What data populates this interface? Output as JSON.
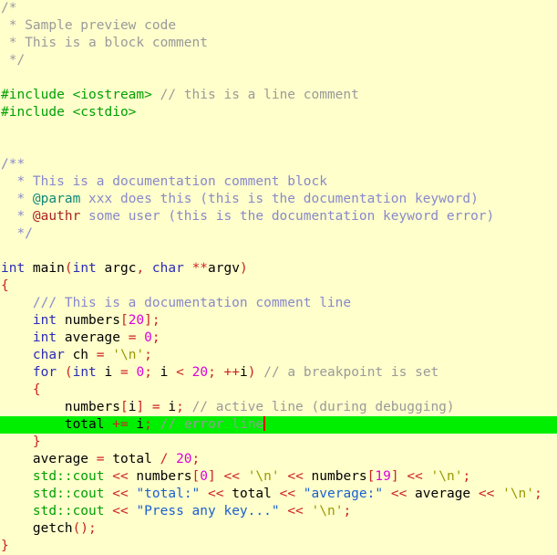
{
  "editor": {
    "language": "C++",
    "background_color": "#ffffcc",
    "highlight_line_color": "#00ee00",
    "caret_color": "#dd0000",
    "colors": {
      "plain": "#000000",
      "keyword": "#2b2bb7",
      "preprocessor": "#00a000",
      "comment": "#9a9a9a",
      "documentation": "#8888cc",
      "documentation_keyword": "#118877",
      "documentation_keyword_error": "#aa2222",
      "number": "#dd00dd",
      "string": "#1a5fd0",
      "character": "#999900",
      "operator": "#cc2222"
    }
  },
  "lines": [
    {
      "id": 1,
      "tokens": [
        {
          "t": "/*",
          "c": "comment"
        }
      ]
    },
    {
      "id": 2,
      "tokens": [
        {
          "t": " * Sample preview code",
          "c": "comment"
        }
      ]
    },
    {
      "id": 3,
      "tokens": [
        {
          "t": " * This is a block comment",
          "c": "comment"
        }
      ]
    },
    {
      "id": 4,
      "tokens": [
        {
          "t": " */",
          "c": "comment"
        }
      ]
    },
    {
      "id": 5,
      "tokens": [
        {
          "t": "",
          "c": "plain"
        }
      ]
    },
    {
      "id": 6,
      "tokens": [
        {
          "t": "#include",
          "c": "preproc"
        },
        {
          "t": " ",
          "c": "plain"
        },
        {
          "t": "<iostream>",
          "c": "preproc"
        },
        {
          "t": " ",
          "c": "plain"
        },
        {
          "t": "// this is a line comment",
          "c": "comment"
        }
      ]
    },
    {
      "id": 7,
      "tokens": [
        {
          "t": "#include",
          "c": "preproc"
        },
        {
          "t": " ",
          "c": "plain"
        },
        {
          "t": "<cstdio>",
          "c": "preproc"
        }
      ]
    },
    {
      "id": 8,
      "tokens": [
        {
          "t": "",
          "c": "plain"
        }
      ]
    },
    {
      "id": 9,
      "tokens": [
        {
          "t": "",
          "c": "plain"
        }
      ]
    },
    {
      "id": 10,
      "tokens": [
        {
          "t": "/**",
          "c": "doc"
        }
      ]
    },
    {
      "id": 11,
      "tokens": [
        {
          "t": "  * This is a documentation comment block",
          "c": "doc"
        }
      ]
    },
    {
      "id": 12,
      "tokens": [
        {
          "t": "  * ",
          "c": "doc"
        },
        {
          "t": "@param",
          "c": "docword"
        },
        {
          "t": " xxx does this (this is the documentation keyword)",
          "c": "doc"
        }
      ]
    },
    {
      "id": 13,
      "tokens": [
        {
          "t": "  * ",
          "c": "doc"
        },
        {
          "t": "@authr",
          "c": "docerr"
        },
        {
          "t": " some user (this is the documentation keyword error)",
          "c": "doc"
        }
      ]
    },
    {
      "id": 14,
      "tokens": [
        {
          "t": "  */",
          "c": "doc"
        }
      ]
    },
    {
      "id": 15,
      "tokens": [
        {
          "t": "",
          "c": "plain"
        }
      ]
    },
    {
      "id": 16,
      "tokens": [
        {
          "t": "int",
          "c": "keyword"
        },
        {
          "t": " main",
          "c": "plain"
        },
        {
          "t": "(",
          "c": "punct"
        },
        {
          "t": "int",
          "c": "keyword"
        },
        {
          "t": " argc",
          "c": "plain"
        },
        {
          "t": ",",
          "c": "punct"
        },
        {
          "t": " ",
          "c": "plain"
        },
        {
          "t": "char",
          "c": "keyword"
        },
        {
          "t": " ",
          "c": "plain"
        },
        {
          "t": "**",
          "c": "punct"
        },
        {
          "t": "argv",
          "c": "plain"
        },
        {
          "t": ")",
          "c": "punct"
        }
      ]
    },
    {
      "id": 17,
      "tokens": [
        {
          "t": "{",
          "c": "punct"
        }
      ]
    },
    {
      "id": 18,
      "tokens": [
        {
          "t": "    ",
          "c": "plain"
        },
        {
          "t": "/// This is a documentation comment line",
          "c": "doc"
        }
      ]
    },
    {
      "id": 19,
      "tokens": [
        {
          "t": "    ",
          "c": "plain"
        },
        {
          "t": "int",
          "c": "keyword"
        },
        {
          "t": " numbers",
          "c": "plain"
        },
        {
          "t": "[",
          "c": "punct"
        },
        {
          "t": "20",
          "c": "number"
        },
        {
          "t": "]",
          "c": "punct"
        },
        {
          "t": ";",
          "c": "punct"
        }
      ]
    },
    {
      "id": 20,
      "tokens": [
        {
          "t": "    ",
          "c": "plain"
        },
        {
          "t": "int",
          "c": "keyword"
        },
        {
          "t": " average ",
          "c": "plain"
        },
        {
          "t": "=",
          "c": "op"
        },
        {
          "t": " ",
          "c": "plain"
        },
        {
          "t": "0",
          "c": "number"
        },
        {
          "t": ";",
          "c": "punct"
        }
      ]
    },
    {
      "id": 21,
      "tokens": [
        {
          "t": "    ",
          "c": "plain"
        },
        {
          "t": "char",
          "c": "keyword"
        },
        {
          "t": " ch ",
          "c": "plain"
        },
        {
          "t": "=",
          "c": "op"
        },
        {
          "t": " ",
          "c": "plain"
        },
        {
          "t": "'\\n'",
          "c": "char"
        },
        {
          "t": ";",
          "c": "punct"
        }
      ]
    },
    {
      "id": 22,
      "tokens": [
        {
          "t": "    ",
          "c": "plain"
        },
        {
          "t": "for",
          "c": "keyword"
        },
        {
          "t": " ",
          "c": "plain"
        },
        {
          "t": "(",
          "c": "punct"
        },
        {
          "t": "int",
          "c": "keyword"
        },
        {
          "t": " i ",
          "c": "plain"
        },
        {
          "t": "=",
          "c": "op"
        },
        {
          "t": " ",
          "c": "plain"
        },
        {
          "t": "0",
          "c": "number"
        },
        {
          "t": ";",
          "c": "punct"
        },
        {
          "t": " i ",
          "c": "plain"
        },
        {
          "t": "<",
          "c": "op"
        },
        {
          "t": " ",
          "c": "plain"
        },
        {
          "t": "20",
          "c": "number"
        },
        {
          "t": ";",
          "c": "punct"
        },
        {
          "t": " ",
          "c": "plain"
        },
        {
          "t": "++",
          "c": "op"
        },
        {
          "t": "i",
          "c": "plain"
        },
        {
          "t": ")",
          "c": "punct"
        },
        {
          "t": " ",
          "c": "plain"
        },
        {
          "t": "// a breakpoint is set",
          "c": "comment"
        }
      ]
    },
    {
      "id": 23,
      "tokens": [
        {
          "t": "    ",
          "c": "plain"
        },
        {
          "t": "{",
          "c": "punct"
        }
      ]
    },
    {
      "id": 24,
      "tokens": [
        {
          "t": "        ",
          "c": "plain"
        },
        {
          "t": "numbers",
          "c": "plain"
        },
        {
          "t": "[",
          "c": "punct"
        },
        {
          "t": "i",
          "c": "plain"
        },
        {
          "t": "]",
          "c": "punct"
        },
        {
          "t": " ",
          "c": "plain"
        },
        {
          "t": "=",
          "c": "op"
        },
        {
          "t": " i",
          "c": "plain"
        },
        {
          "t": ";",
          "c": "punct"
        },
        {
          "t": " ",
          "c": "plain"
        },
        {
          "t": "// active line (during debugging)",
          "c": "comment"
        }
      ]
    },
    {
      "id": 25,
      "highlighted": true,
      "caret_after": true,
      "tokens": [
        {
          "t": "        ",
          "c": "plain"
        },
        {
          "t": "total ",
          "c": "plain"
        },
        {
          "t": "+=",
          "c": "op"
        },
        {
          "t": " i",
          "c": "plain"
        },
        {
          "t": ";",
          "c": "punct"
        },
        {
          "t": " ",
          "c": "plain"
        },
        {
          "t": "// error line",
          "c": "comment"
        }
      ]
    },
    {
      "id": 26,
      "tokens": [
        {
          "t": "    ",
          "c": "plain"
        },
        {
          "t": "}",
          "c": "punct"
        }
      ]
    },
    {
      "id": 27,
      "tokens": [
        {
          "t": "    average ",
          "c": "plain"
        },
        {
          "t": "=",
          "c": "op"
        },
        {
          "t": " total ",
          "c": "plain"
        },
        {
          "t": "/",
          "c": "op"
        },
        {
          "t": " ",
          "c": "plain"
        },
        {
          "t": "20",
          "c": "number"
        },
        {
          "t": ";",
          "c": "punct"
        }
      ]
    },
    {
      "id": 28,
      "tokens": [
        {
          "t": "    ",
          "c": "plain"
        },
        {
          "t": "std::cout",
          "c": "preproc"
        },
        {
          "t": " ",
          "c": "plain"
        },
        {
          "t": "<<",
          "c": "op"
        },
        {
          "t": " numbers",
          "c": "plain"
        },
        {
          "t": "[",
          "c": "punct"
        },
        {
          "t": "0",
          "c": "number"
        },
        {
          "t": "]",
          "c": "punct"
        },
        {
          "t": " ",
          "c": "plain"
        },
        {
          "t": "<<",
          "c": "op"
        },
        {
          "t": " ",
          "c": "plain"
        },
        {
          "t": "'\\n'",
          "c": "char"
        },
        {
          "t": " ",
          "c": "plain"
        },
        {
          "t": "<<",
          "c": "op"
        },
        {
          "t": " numbers",
          "c": "plain"
        },
        {
          "t": "[",
          "c": "punct"
        },
        {
          "t": "19",
          "c": "number"
        },
        {
          "t": "]",
          "c": "punct"
        },
        {
          "t": " ",
          "c": "plain"
        },
        {
          "t": "<<",
          "c": "op"
        },
        {
          "t": " ",
          "c": "plain"
        },
        {
          "t": "'\\n'",
          "c": "char"
        },
        {
          "t": ";",
          "c": "punct"
        }
      ]
    },
    {
      "id": 29,
      "tokens": [
        {
          "t": "    ",
          "c": "plain"
        },
        {
          "t": "std::cout",
          "c": "preproc"
        },
        {
          "t": " ",
          "c": "plain"
        },
        {
          "t": "<<",
          "c": "op"
        },
        {
          "t": " ",
          "c": "plain"
        },
        {
          "t": "\"total:\"",
          "c": "string"
        },
        {
          "t": " ",
          "c": "plain"
        },
        {
          "t": "<<",
          "c": "op"
        },
        {
          "t": " total ",
          "c": "plain"
        },
        {
          "t": "<<",
          "c": "op"
        },
        {
          "t": " ",
          "c": "plain"
        },
        {
          "t": "\"average:\"",
          "c": "string"
        },
        {
          "t": " ",
          "c": "plain"
        },
        {
          "t": "<<",
          "c": "op"
        },
        {
          "t": " average ",
          "c": "plain"
        },
        {
          "t": "<<",
          "c": "op"
        },
        {
          "t": " ",
          "c": "plain"
        },
        {
          "t": "'\\n'",
          "c": "char"
        },
        {
          "t": ";",
          "c": "punct"
        }
      ]
    },
    {
      "id": 30,
      "tokens": [
        {
          "t": "    ",
          "c": "plain"
        },
        {
          "t": "std::cout",
          "c": "preproc"
        },
        {
          "t": " ",
          "c": "plain"
        },
        {
          "t": "<<",
          "c": "op"
        },
        {
          "t": " ",
          "c": "plain"
        },
        {
          "t": "\"Press any key...\"",
          "c": "string"
        },
        {
          "t": " ",
          "c": "plain"
        },
        {
          "t": "<<",
          "c": "op"
        },
        {
          "t": " ",
          "c": "plain"
        },
        {
          "t": "'\\n'",
          "c": "char"
        },
        {
          "t": ";",
          "c": "punct"
        }
      ]
    },
    {
      "id": 31,
      "tokens": [
        {
          "t": "    getch",
          "c": "plain"
        },
        {
          "t": "()",
          "c": "punct"
        },
        {
          "t": ";",
          "c": "punct"
        }
      ]
    },
    {
      "id": 32,
      "tokens": [
        {
          "t": "}",
          "c": "punct"
        }
      ]
    }
  ]
}
